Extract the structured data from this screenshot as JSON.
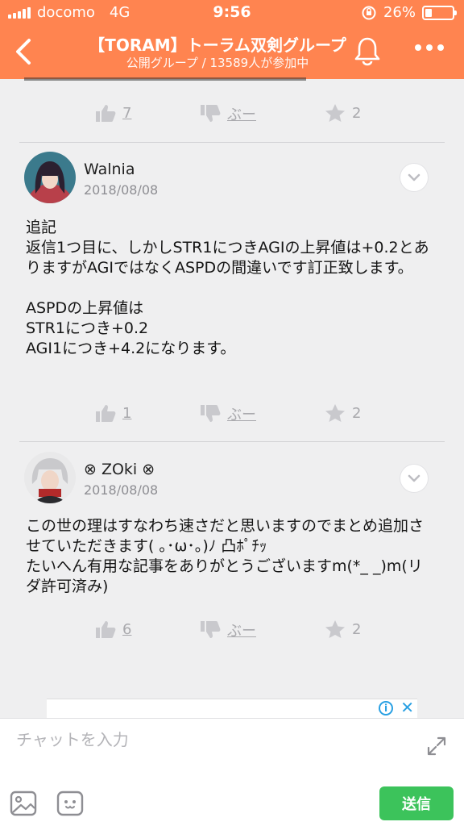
{
  "status_bar": {
    "carrier": "docomo",
    "network": "4G",
    "time": "9:56",
    "battery": "26%",
    "battery_level": 0.26
  },
  "header": {
    "title": "【TORAM】トーラム双剣グループ",
    "subtitle": "公開グループ / 13589人が参加中",
    "color": "#ff8450"
  },
  "posts": [
    {
      "likes": "7",
      "boo": "ぶー",
      "stars": "2"
    },
    {
      "username": "Walnia",
      "date": "2018/08/08",
      "text": "追記\n返信1つ目に、しかしSTR1につきAGIの上昇値は+0.2とありますがAGIではなくASPDの間違いです訂正致します。\n\nASPDの上昇値は\nSTR1につき+0.2\nAGI1につき+4.2になります。",
      "likes": "1",
      "boo": "ぶー",
      "stars": "2"
    },
    {
      "username": "⊗ ZOki ⊗",
      "date": "2018/08/08",
      "text": "この世の理はすなわち速さだと思いますのでまとめ追加させていただきます( ｡･ω･｡)ﾉ 凸ﾎﾟﾁｯ\nたいへん有用な記事をありがとうございますm(*_ _)m(リダ許可済み)",
      "likes": "6",
      "boo": "ぶー",
      "stars": "2"
    }
  ],
  "composer": {
    "placeholder": "チャットを入力",
    "send_label": "送信",
    "send_color": "#3cc35b"
  }
}
